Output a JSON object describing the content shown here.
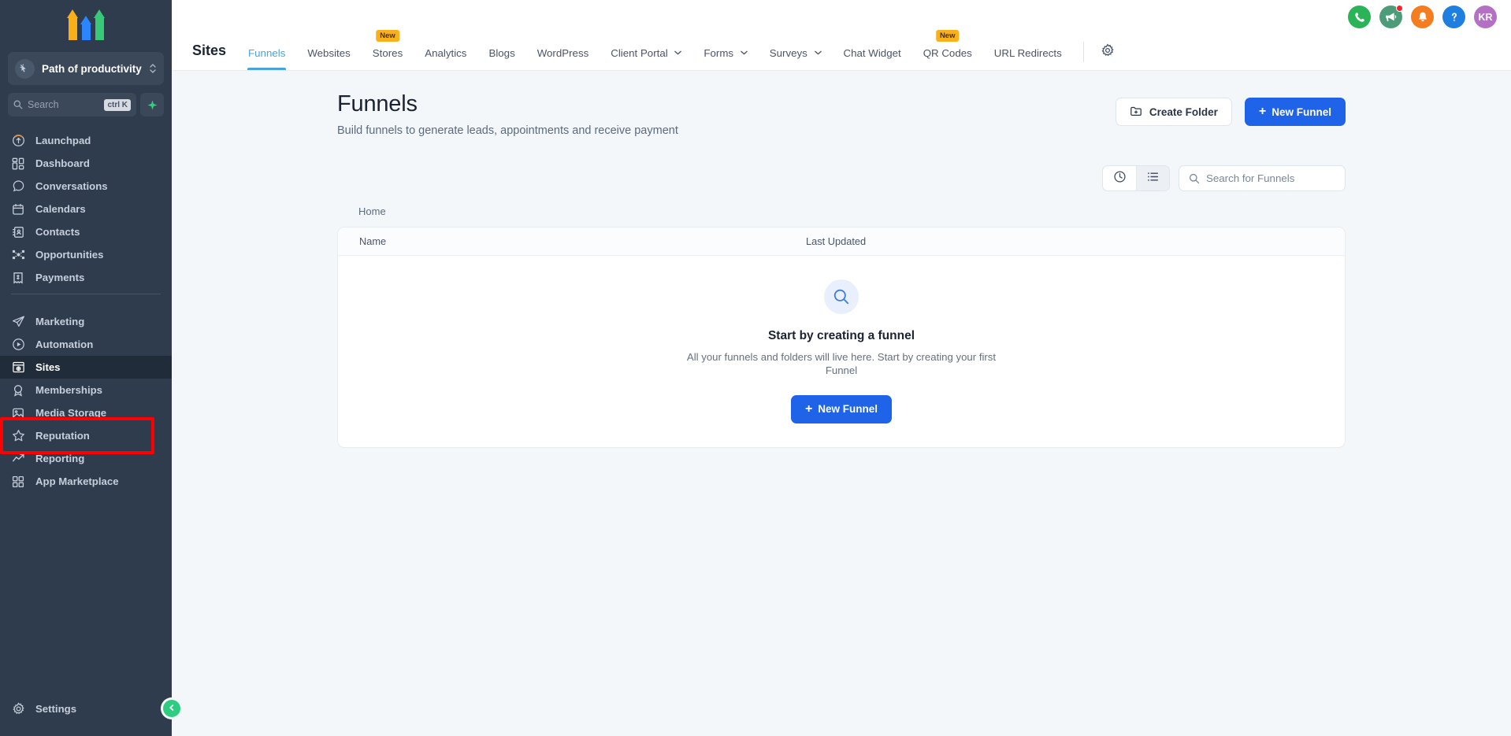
{
  "brand": {
    "logo_icon": "three-up-arrows-logo",
    "colors": {
      "yellow": "#f9b018",
      "blue": "#2a85ff",
      "green": "#37c978"
    }
  },
  "sidebar": {
    "account": {
      "name": "Path of productivity",
      "avatar_icon": "cursor-click-icon",
      "switch_icon": "chevron-up-down-icon"
    },
    "search": {
      "placeholder": "Search",
      "shortcut": "ctrl K",
      "icon": "search-icon",
      "ai_icon": "sparkle-icon"
    },
    "groups": [
      {
        "items": [
          {
            "label": "Launchpad",
            "icon": "rocket-launchpad-icon"
          },
          {
            "label": "Dashboard",
            "icon": "dashboard-grid-icon"
          },
          {
            "label": "Conversations",
            "icon": "chat-bubble-icon"
          },
          {
            "label": "Calendars",
            "icon": "calendar-icon"
          },
          {
            "label": "Contacts",
            "icon": "contact-book-icon"
          },
          {
            "label": "Opportunities",
            "icon": "opportunities-nodes-icon"
          },
          {
            "label": "Payments",
            "icon": "payments-receipt-icon"
          }
        ]
      },
      {
        "items": [
          {
            "label": "Marketing",
            "icon": "paper-plane-icon"
          },
          {
            "label": "Automation",
            "icon": "play-circle-icon"
          },
          {
            "label": "Sites",
            "icon": "browser-window-icon",
            "active": true,
            "annotated": true
          },
          {
            "label": "Memberships",
            "icon": "membership-badge-icon"
          },
          {
            "label": "Media Storage",
            "icon": "image-icon"
          },
          {
            "label": "Reputation",
            "icon": "star-icon"
          },
          {
            "label": "Reporting",
            "icon": "trend-up-icon"
          },
          {
            "label": "App Marketplace",
            "icon": "apps-grid-icon"
          }
        ]
      }
    ],
    "settings": {
      "label": "Settings",
      "icon": "gear-icon"
    },
    "collapse": {
      "icon": "chevron-left-icon",
      "color": "#2ecc80"
    }
  },
  "topbar": {
    "icons": [
      {
        "name": "phone-dialer-icon",
        "glyph": "phone",
        "color": "#2bb457"
      },
      {
        "name": "announcement-megaphone-icon",
        "glyph": "megaphone",
        "color": "#4c9c7a",
        "badge": true
      },
      {
        "name": "notifications-bell-icon",
        "glyph": "bell",
        "color": "#f57c1f"
      },
      {
        "name": "help-icon",
        "glyph": "question",
        "color": "#1e7fe0"
      }
    ],
    "avatar": {
      "initials": "KR",
      "color": "#b471c4"
    },
    "brandname": "Sites",
    "tabs": [
      {
        "label": "Funnels",
        "active": true
      },
      {
        "label": "Websites"
      },
      {
        "label": "Stores",
        "badge": "New"
      },
      {
        "label": "Analytics"
      },
      {
        "label": "Blogs"
      },
      {
        "label": "WordPress"
      },
      {
        "label": "Client Portal",
        "dropdown": true
      },
      {
        "label": "Forms",
        "dropdown": true
      },
      {
        "label": "Surveys",
        "dropdown": true
      },
      {
        "label": "Chat Widget"
      },
      {
        "label": "QR Codes",
        "badge": "New"
      },
      {
        "label": "URL Redirects"
      }
    ],
    "settings_gear": "gear-icon"
  },
  "page": {
    "title": "Funnels",
    "subtitle": "Build funnels to generate leads, appointments and receive payment",
    "create_folder_label": "Create Folder",
    "create_folder_icon": "folder-plus-icon",
    "new_funnel_label": "New Funnel",
    "new_funnel_plus": "+",
    "toolbar": {
      "recent_view_icon": "clock-icon",
      "list_view_icon": "list-icon",
      "active_view": "list",
      "search_placeholder": "Search for Funnels",
      "search_icon": "search-icon",
      "search_value": ""
    },
    "breadcrumb": "Home",
    "table": {
      "columns": [
        "Name",
        "Last Updated"
      ],
      "rows": []
    },
    "empty_state": {
      "icon": "magnifier-icon",
      "title": "Start by creating a funnel",
      "description": "All your funnels and folders will live here. Start by creating your first Funnel",
      "button_label": "New Funnel",
      "button_plus": "+"
    }
  },
  "annotation": {
    "target": "Sites",
    "color": "#ff0000"
  }
}
